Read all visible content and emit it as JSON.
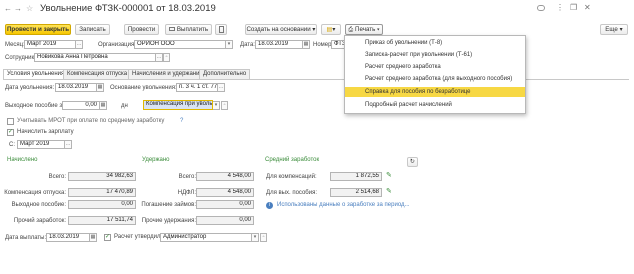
{
  "window": {
    "title": "Увольнение ФТЗК-000001 от 18.03.2019",
    "nav_back": "←",
    "nav_forward": "→",
    "star": "☆",
    "more_dots": "⋮",
    "restore": "❐",
    "close": "✕"
  },
  "toolbar": {
    "post_close": "Провести и закрыть",
    "save": "Записать",
    "post": "Провести",
    "pay": "Выплатить",
    "create_based": "Создать на основании",
    "print": "Печать",
    "more": "Еще"
  },
  "print_menu": {
    "items": [
      "Приказ об увольнении (Т-8)",
      "Записка-расчет при увольнении (Т-61)",
      "Расчет среднего заработка",
      "Расчет среднего заработка (для выходного пособия)",
      "Справка для пособия по безработице",
      "Подробный расчет начислений"
    ],
    "highlighted_index": 4,
    "highlight_color": "#f7d844"
  },
  "header": {
    "month_label": "Месяц:",
    "month_value": "Март 2019",
    "org_label": "Организация:",
    "org_value": "ОРИОН ООО",
    "date_label": "Дата:",
    "date_value": "18.03.2019",
    "number_label": "Номер:",
    "number_value": "ФТЗ",
    "employee_label": "Сотрудник:",
    "employee_value": "Новикова Анна Петровна"
  },
  "tabs": [
    "Условия увольнения",
    "Компенсация отпуска",
    "Начисления и удержания",
    "Дополнительно"
  ],
  "conditions": {
    "dismissal_date_label": "Дата увольнения:",
    "dismissal_date": "18.03.2019",
    "basis_label": "Основание увольнения:",
    "basis_value": "п. 3 ч. 1 ст. 77",
    "severance_label": "Выходное пособие за:",
    "severance_days": "0,00",
    "days_unit": "дн",
    "severance_type": "Компенсация при увольн",
    "mrot_label": "Учитывать МРОТ при оплате по среднему заработку",
    "mrot_checked": false,
    "help": "?",
    "accrue_label": "Начислить зарплату",
    "accrue_checked": true,
    "from_label": "С:",
    "from_value": "Март 2019"
  },
  "accrued": {
    "title": "Начислено",
    "total_label": "Всего:",
    "total": "34 982,63",
    "vacation_label": "Компенсация отпуска:",
    "vacation": "17 470,89",
    "severance_label": "Выходное пособие:",
    "severance": "0,00",
    "other_label": "Прочий заработок:",
    "other": "17 511,74"
  },
  "withheld": {
    "title": "Удержано",
    "total_label": "Всего:",
    "total": "4 548,00",
    "ndfl_label": "НДФЛ:",
    "ndfl": "4 548,00",
    "loans_label": "Погашение займов:",
    "loans": "0,00",
    "other_label": "Прочие удержания:",
    "other": "0,00"
  },
  "average": {
    "title": "Средний заработок",
    "comp_label": "Для компенсаций:",
    "comp": "1 872,55",
    "sev_label": "Для вых. пособия:",
    "sev": "2 514,68",
    "info_text": "Использованы данные о заработке за период..."
  },
  "footer": {
    "pay_date_label": "Дата выплаты:",
    "pay_date": "18.03.2019",
    "approved_label": "Расчет утвердил:",
    "approved_checked": true,
    "approved_value": "Администратор"
  },
  "colors": {
    "accent_yellow": "#f6c600",
    "green": "#3a8c3a",
    "link": "#4a7fbf"
  }
}
